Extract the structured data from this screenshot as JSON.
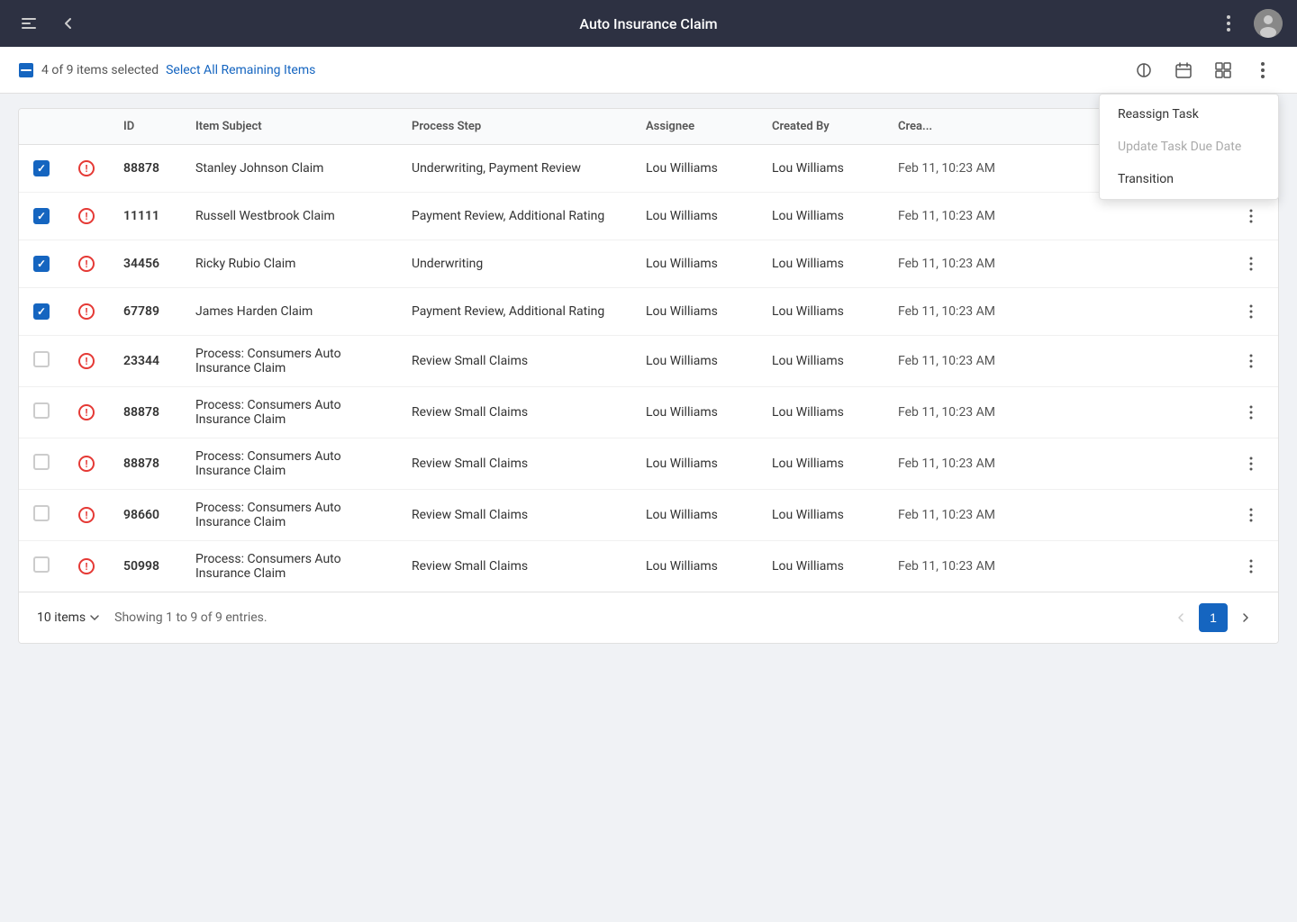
{
  "topNav": {
    "title": "Auto Insurance Claim",
    "toggleSidebarLabel": "Toggle Sidebar",
    "backLabel": "Back",
    "moreOptionsLabel": "More Options"
  },
  "selectionBar": {
    "text": "4 of 9 items selected",
    "selectAllLabel": "Select All Remaining Items",
    "actions": {
      "filterLabel": "Filter",
      "calendarLabel": "Calendar",
      "layoutLabel": "Layout",
      "moreLabel": "More"
    }
  },
  "dropdownMenu": {
    "items": [
      {
        "label": "Reassign Task",
        "disabled": false
      },
      {
        "label": "Update Task Due Date",
        "disabled": true
      },
      {
        "label": "Transition",
        "disabled": false
      }
    ]
  },
  "table": {
    "columns": [
      "",
      "",
      "ID",
      "Item Subject",
      "Process Step",
      "Assignee",
      "Created By",
      "Created",
      ""
    ],
    "rows": [
      {
        "checked": true,
        "id": "88878",
        "subject": "Stanley Johnson Claim",
        "processStep": "Underwriting, Payment Review",
        "assignee": "Lou Williams",
        "createdBy": "Lou Williams",
        "created": "Feb 11, 10:23 AM"
      },
      {
        "checked": true,
        "id": "11111",
        "subject": "Russell Westbrook Claim",
        "processStep": "Payment Review, Additional Rating",
        "assignee": "Lou Williams",
        "createdBy": "Lou Williams",
        "created": "Feb 11, 10:23 AM"
      },
      {
        "checked": true,
        "id": "34456",
        "subject": "Ricky Rubio Claim",
        "processStep": "Underwriting",
        "assignee": "Lou Williams",
        "createdBy": "Lou Williams",
        "created": "Feb 11, 10:23 AM"
      },
      {
        "checked": true,
        "id": "67789",
        "subject": "James Harden Claim",
        "processStep": "Payment Review, Additional Rating",
        "assignee": "Lou Williams",
        "createdBy": "Lou Williams",
        "created": "Feb 11, 10:23 AM"
      },
      {
        "checked": false,
        "id": "23344",
        "subject": "Process: Consumers Auto Insurance Claim",
        "processStep": "Review Small Claims",
        "assignee": "Lou Williams",
        "createdBy": "Lou Williams",
        "created": "Feb 11, 10:23 AM"
      },
      {
        "checked": false,
        "id": "88878",
        "subject": "Process: Consumers Auto Insurance Claim",
        "processStep": "Review Small Claims",
        "assignee": "Lou Williams",
        "createdBy": "Lou Williams",
        "created": "Feb 11, 10:23 AM"
      },
      {
        "checked": false,
        "id": "88878",
        "subject": "Process: Consumers Auto Insurance Claim",
        "processStep": "Review Small Claims",
        "assignee": "Lou Williams",
        "createdBy": "Lou Williams",
        "created": "Feb 11, 10:23 AM"
      },
      {
        "checked": false,
        "id": "98660",
        "subject": "Process: Consumers Auto Insurance Claim",
        "processStep": "Review Small Claims",
        "assignee": "Lou Williams",
        "createdBy": "Lou Williams",
        "created": "Feb 11, 10:23 AM"
      },
      {
        "checked": false,
        "id": "50998",
        "subject": "Process: Consumers Auto Insurance Claim",
        "processStep": "Review Small Claims",
        "assignee": "Lou Williams",
        "createdBy": "Lou Williams",
        "created": "Feb 11, 10:23 AM"
      }
    ]
  },
  "footer": {
    "itemsPerPage": "10 items",
    "showingText": "Showing 1 to 9 of 9 entries.",
    "currentPage": "1"
  },
  "colors": {
    "brand": "#1565c0",
    "priority": "#e53935",
    "navBg": "#2d3142"
  }
}
